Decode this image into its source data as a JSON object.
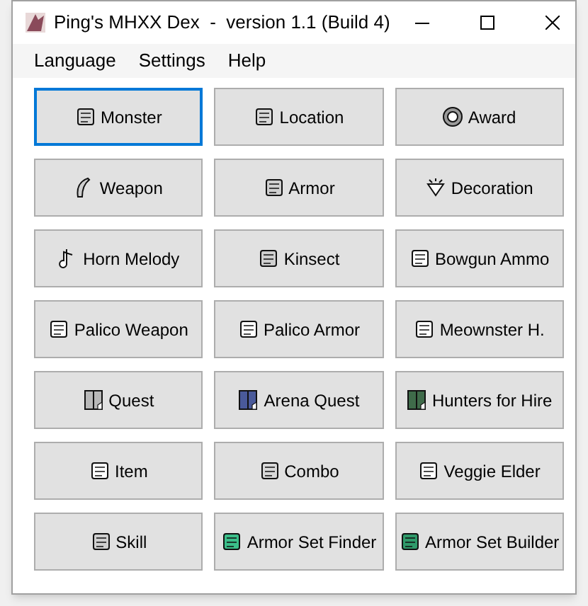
{
  "window": {
    "title": "Ping's MHXX Dex  -  version 1.1 (Build 4)"
  },
  "menu": [
    "Language",
    "Settings",
    "Help"
  ],
  "buttons": [
    {
      "label": "Monster",
      "selected": true
    },
    {
      "label": "Location",
      "selected": false
    },
    {
      "label": "Award",
      "selected": false
    },
    {
      "label": "Weapon",
      "selected": false
    },
    {
      "label": "Armor",
      "selected": false
    },
    {
      "label": "Decoration",
      "selected": false
    },
    {
      "label": "Horn Melody",
      "selected": false
    },
    {
      "label": "Kinsect",
      "selected": false
    },
    {
      "label": "Bowgun Ammo",
      "selected": false
    },
    {
      "label": "Palico Weapon",
      "selected": false
    },
    {
      "label": "Palico Armor",
      "selected": false
    },
    {
      "label": "Meownster H.",
      "selected": false
    },
    {
      "label": "Quest",
      "selected": false
    },
    {
      "label": "Arena Quest",
      "selected": false
    },
    {
      "label": "Hunters for Hire",
      "selected": false
    },
    {
      "label": "Item",
      "selected": false
    },
    {
      "label": "Combo",
      "selected": false
    },
    {
      "label": "Veggie Elder",
      "selected": false
    },
    {
      "label": "Skill",
      "selected": false
    },
    {
      "label": "Armor Set Finder",
      "selected": false
    },
    {
      "label": "Armor Set Builder",
      "selected": false
    }
  ]
}
